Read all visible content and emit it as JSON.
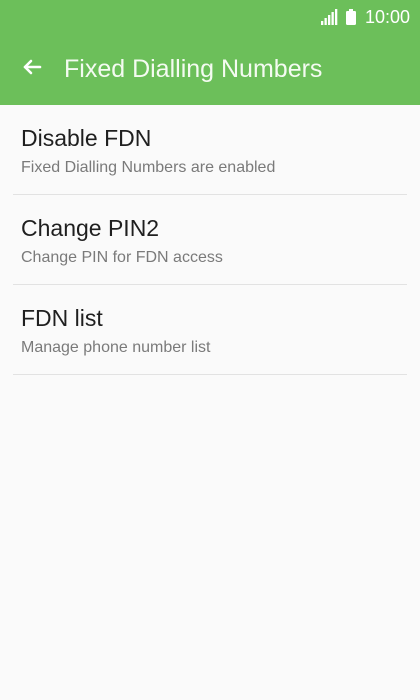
{
  "status_bar": {
    "time": "10:00",
    "icons": [
      "signal-icon",
      "battery-icon"
    ]
  },
  "toolbar": {
    "title": "Fixed Dialling Numbers",
    "back_icon": "arrow-left-icon"
  },
  "list": {
    "items": [
      {
        "title": "Disable FDN",
        "subtitle": "Fixed Dialling Numbers are enabled"
      },
      {
        "title": "Change PIN2",
        "subtitle": "Change PIN for FDN access"
      },
      {
        "title": "FDN list",
        "subtitle": "Manage phone number list"
      }
    ]
  },
  "colors": {
    "accent": "#6cbf5a",
    "background": "#fafafa",
    "title_text": "#1f1f1f",
    "subtitle_text": "#7a7a7a",
    "divider": "#e2e2e2"
  }
}
